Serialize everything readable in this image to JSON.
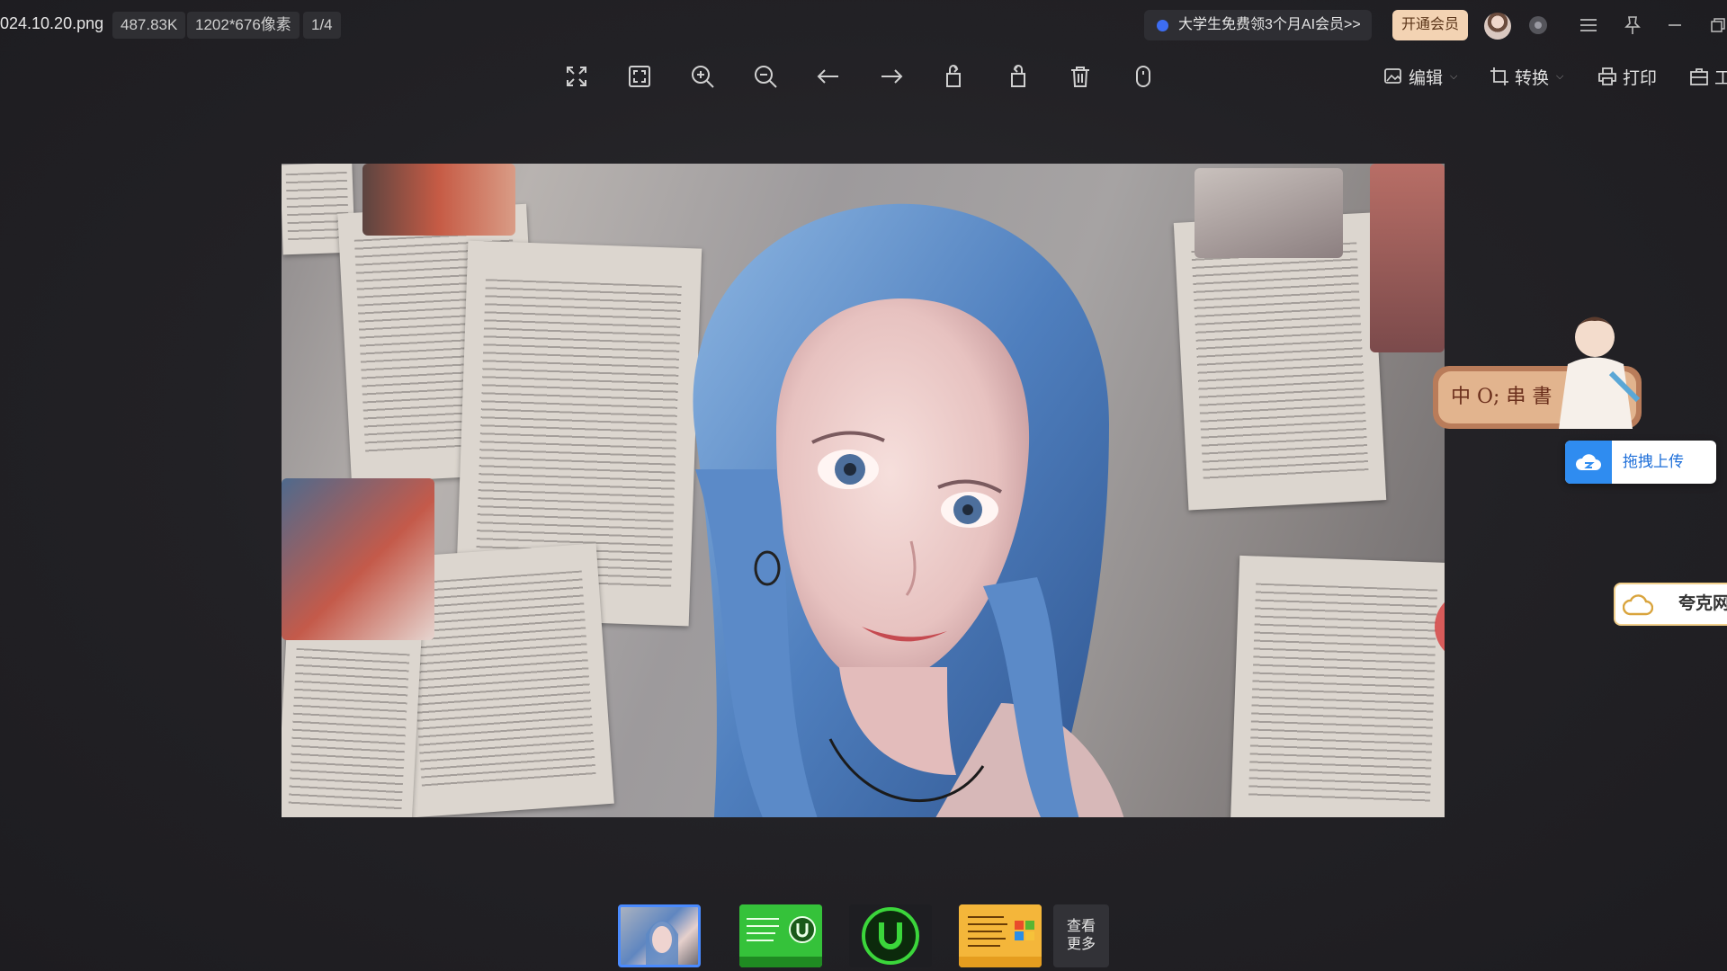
{
  "file": {
    "name": "024.10.20.png",
    "size": "487.83K",
    "dimensions": "1202*676像素",
    "index": "1/4"
  },
  "promo": {
    "text": "大学生免费领3个月AI会员>>"
  },
  "vip": {
    "label": "开通会员"
  },
  "toolbar": {
    "tools": [
      "fullscreen-icon",
      "fit-window-icon",
      "zoom-in-icon",
      "zoom-out-icon",
      "previous-arrow-icon",
      "next-arrow-icon",
      "rotate-left-icon",
      "rotate-right-icon",
      "delete-icon",
      "info-icon"
    ],
    "edit_label": "编辑",
    "convert_label": "转换",
    "print_label": "打印",
    "tools_label": "工"
  },
  "widgets": {
    "upload_label": "拖拽上传",
    "quark_label": "夸克网"
  },
  "mascot": {
    "banner_text": "中 O; 串 書"
  },
  "thumbnails": {
    "more_label_1": "查看",
    "more_label_2": "更多"
  },
  "colors": {
    "accent": "#4a8bff",
    "vip_bg": "#f3d3b3",
    "cursor_highlight": "#d64040",
    "upload_blue": "#2f8cf0"
  }
}
